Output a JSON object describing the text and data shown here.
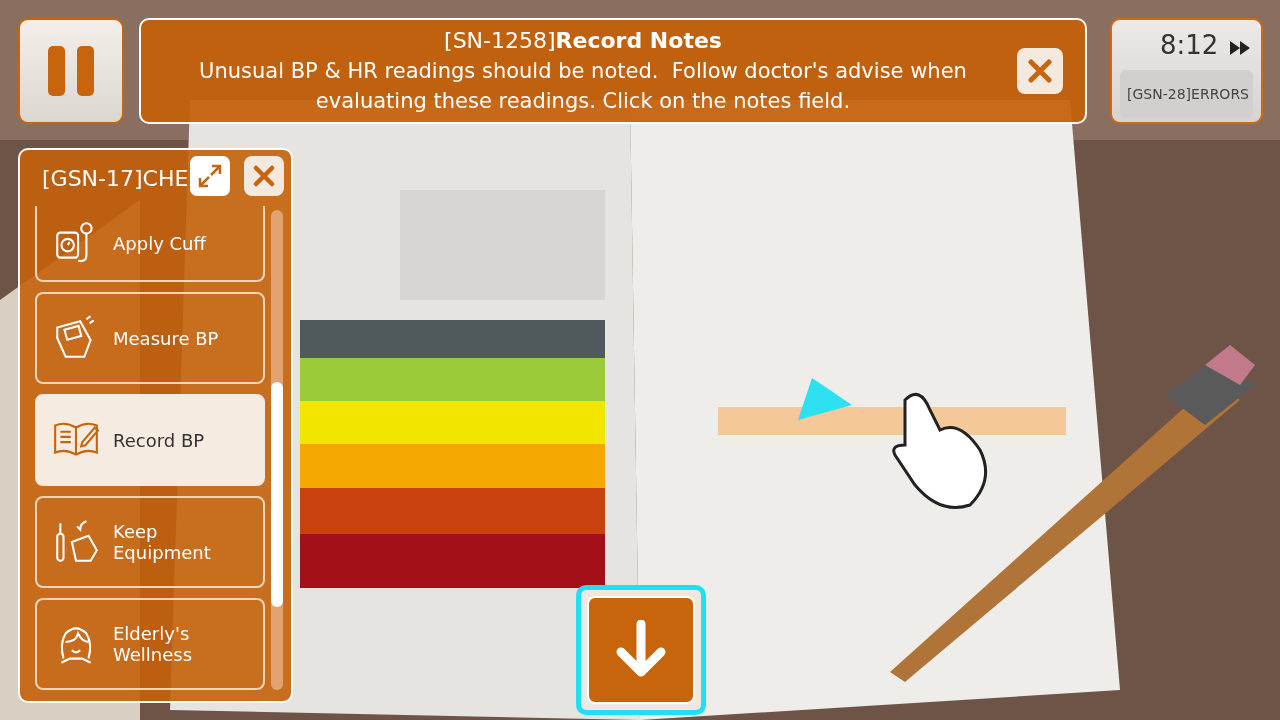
{
  "notice": {
    "title": "[SN-1258]**Record Notes**",
    "message": "Unusual BP & HR readings should be noted.  Follow doctor's advise when evaluating these readings. Click on the notes field."
  },
  "timer": {
    "time": "8:12",
    "errors_label": "[GSN-28]ERRORS"
  },
  "checklist": {
    "title": "[GSN-17]CHE",
    "items": [
      {
        "label": "Apply Cuff",
        "selected": false
      },
      {
        "label": "Measure BP",
        "selected": false
      },
      {
        "label": "Record BP",
        "selected": true
      },
      {
        "label": "Keep Equipment",
        "selected": false
      },
      {
        "label": "Elderly's Wellness",
        "selected": false
      }
    ]
  }
}
